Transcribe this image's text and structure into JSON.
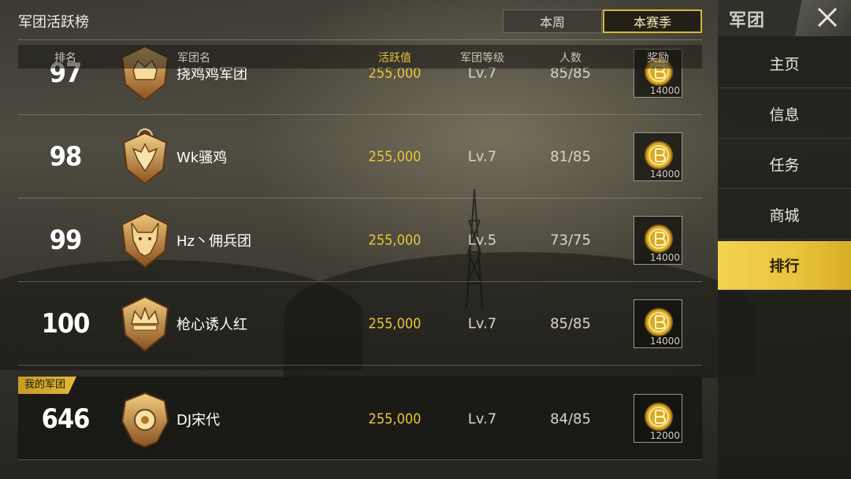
{
  "header": {
    "title": "军团活跃榜",
    "tabs": [
      {
        "label": "本周",
        "selected": false
      },
      {
        "label": "本赛季",
        "selected": true
      }
    ]
  },
  "columns": {
    "rank": "排名",
    "name": "军团名",
    "activity": "活跃值",
    "level": "军团等级",
    "members": "人数",
    "reward": "奖励"
  },
  "rows": [
    {
      "rank": "97",
      "name": "挠鸡鸡军团",
      "activity": "255,000",
      "level": "Lv.7",
      "members": "85/85",
      "reward": "14000",
      "emblem": "crown-emblem-icon"
    },
    {
      "rank": "98",
      "name": "Wk骚鸡",
      "activity": "255,000",
      "level": "Lv.7",
      "members": "81/85",
      "reward": "14000",
      "emblem": "eagle-emblem-icon"
    },
    {
      "rank": "99",
      "name": "Hz丶佣兵团",
      "activity": "255,000",
      "level": "Lv.5",
      "members": "73/75",
      "reward": "14000",
      "emblem": "wolf-emblem-icon"
    },
    {
      "rank": "100",
      "name": "枪心诱人红",
      "activity": "255,000",
      "level": "Lv.7",
      "members": "85/85",
      "reward": "14000",
      "emblem": "crown-emblem-icon"
    }
  ],
  "my_guild": {
    "tag": "我的军团",
    "rank": "646",
    "name": "DJ宋代",
    "activity": "255,000",
    "level": "Lv.7",
    "members": "84/85",
    "reward": "12000",
    "emblem": "wreath-emblem-icon"
  },
  "sidebar": {
    "title": "军团",
    "items": [
      {
        "label": "主页",
        "active": false
      },
      {
        "label": "信息",
        "active": false
      },
      {
        "label": "任务",
        "active": false
      },
      {
        "label": "商城",
        "active": false
      },
      {
        "label": "排行",
        "active": true
      }
    ]
  },
  "colors": {
    "accent": "#e9c33c",
    "activity_text": "#e9c53a"
  }
}
